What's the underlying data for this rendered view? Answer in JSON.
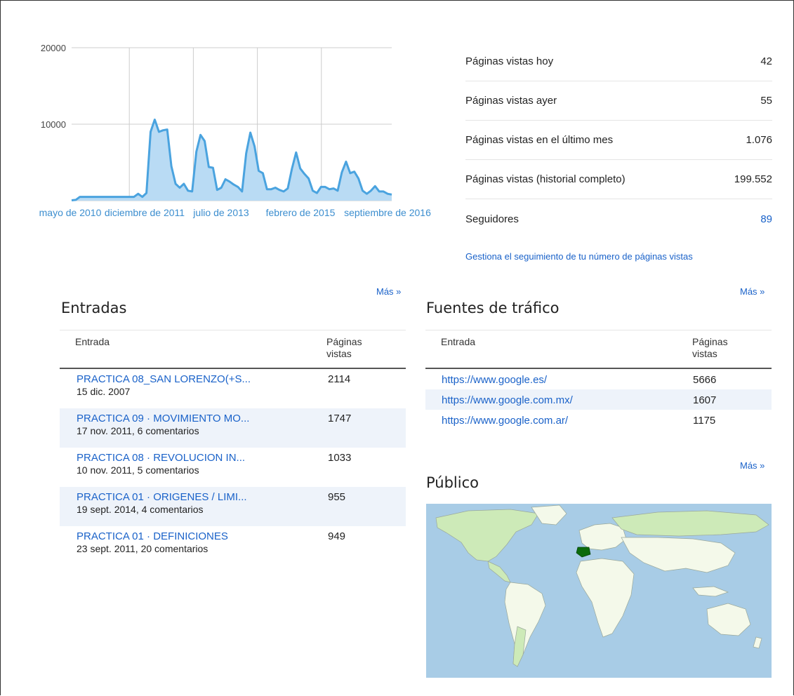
{
  "chart_data": {
    "type": "area",
    "x_labels": [
      "mayo de 2010",
      "diciembre de 2011",
      "julio de 2013",
      "febrero de 2015",
      "septiembre de 2016"
    ],
    "yticks": [
      "20000",
      "10000"
    ],
    "ylim": [
      0,
      20000
    ],
    "grid": true,
    "color": "#4aa3df",
    "fill": "#b9dbf4",
    "values": [
      50,
      100,
      500,
      500,
      500,
      500,
      500,
      500,
      500,
      500,
      500,
      500,
      500,
      500,
      500,
      500,
      900,
      500,
      1000,
      9000,
      10600,
      9000,
      9200,
      9300,
      4500,
      2200,
      1700,
      2200,
      1300,
      1200,
      6400,
      8600,
      7800,
      4400,
      4300,
      1400,
      1700,
      2800,
      2500,
      2100,
      1800,
      1200,
      6200,
      8900,
      7100,
      3900,
      3600,
      1500,
      1500,
      1700,
      1400,
      1200,
      1600,
      4200,
      6300,
      4200,
      3500,
      2900,
      1300,
      1000,
      1800,
      1800,
      1500,
      1600,
      1300,
      3700,
      5100,
      3600,
      3800,
      2900,
      1300,
      900,
      1300,
      1900,
      1200,
      1200,
      900,
      800
    ]
  },
  "stats": {
    "rows": [
      {
        "label": "Páginas vistas hoy",
        "value": "42"
      },
      {
        "label": "Páginas vistas ayer",
        "value": "55"
      },
      {
        "label": "Páginas vistas en el último mes",
        "value": "1.076"
      },
      {
        "label": "Páginas vistas (historial completo)",
        "value": "199.552"
      },
      {
        "label": "Seguidores",
        "value": "89"
      }
    ],
    "manage_link": "Gestiona el seguimiento de tu número de páginas vistas"
  },
  "entradas": {
    "more": "Más »",
    "title": "Entradas",
    "col_entry": "Entrada",
    "col_views": "Páginas vistas",
    "rows": [
      {
        "title": "PRACTICA 08_SAN LORENZO(+S...",
        "meta": "15 dic. 2007",
        "views": "2114"
      },
      {
        "title": "PRACTICA 09 · MOVIMIENTO MO...",
        "meta": "17 nov. 2011, 6 comentarios",
        "views": "1747"
      },
      {
        "title": "PRACTICA 08 · REVOLUCION IN...",
        "meta": "10 nov. 2011, 5 comentarios",
        "views": "1033"
      },
      {
        "title": "PRACTICA 01 · ORIGENES / LIMI...",
        "meta": "19 sept. 2014, 4 comentarios",
        "views": "955"
      },
      {
        "title": "PRACTICA 01 · DEFINICIONES",
        "meta": "23 sept. 2011, 20 comentarios",
        "views": "949"
      }
    ]
  },
  "fuentes": {
    "more": "Más »",
    "title": "Fuentes de tráfico",
    "col_entry": "Entrada",
    "col_views": "Páginas vistas",
    "rows": [
      {
        "url": "https://www.google.es/",
        "views": "5666"
      },
      {
        "url": "https://www.google.com.mx/",
        "views": "1607"
      },
      {
        "url": "https://www.google.com.ar/",
        "views": "1175"
      }
    ]
  },
  "publico": {
    "more": "Más »",
    "title": "Público",
    "colors": {
      "ocean": "#a8cce6",
      "land": "#f4f9ea",
      "light": "#cdeab8",
      "dark": "#0b6b0b",
      "border": "#9aa89a"
    }
  }
}
